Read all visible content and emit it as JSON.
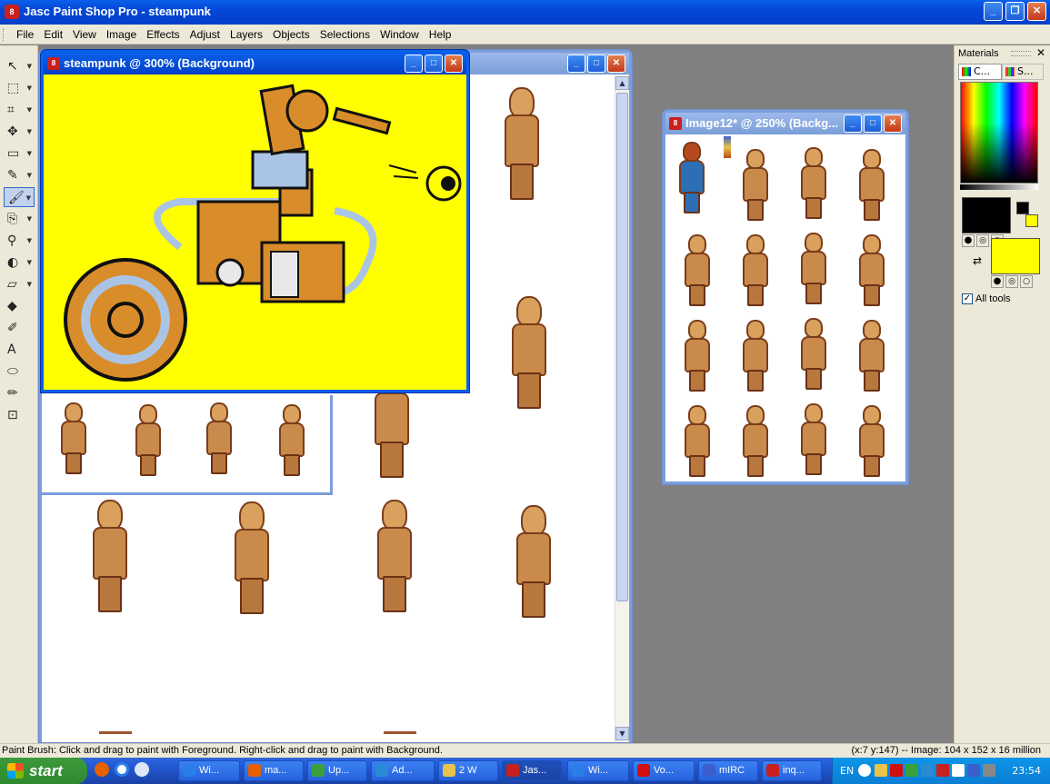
{
  "window": {
    "title": "Jasc Paint Shop Pro - steampunk",
    "icon_text": "8"
  },
  "menu": [
    "File",
    "Edit",
    "View",
    "Image",
    "Effects",
    "Adjust",
    "Layers",
    "Objects",
    "Selections",
    "Window",
    "Help"
  ],
  "tools": [
    {
      "name": "pan",
      "glyph": "↖"
    },
    {
      "name": "selection",
      "glyph": "⬚"
    },
    {
      "name": "crop",
      "glyph": "⌗"
    },
    {
      "name": "move",
      "glyph": "✥"
    },
    {
      "name": "select-rect",
      "glyph": "▭"
    },
    {
      "name": "dropper",
      "glyph": "✎"
    },
    {
      "name": "paint-brush",
      "glyph": "🖌"
    },
    {
      "name": "clone",
      "glyph": "⎘"
    },
    {
      "name": "zoom",
      "glyph": "⚲"
    },
    {
      "name": "dodge",
      "glyph": "◐"
    },
    {
      "name": "eraser",
      "glyph": "▱"
    },
    {
      "name": "fill",
      "glyph": "◆"
    },
    {
      "name": "pen",
      "glyph": "✐"
    },
    {
      "name": "text",
      "glyph": "A"
    },
    {
      "name": "shape",
      "glyph": "⬭"
    },
    {
      "name": "pencil",
      "glyph": "✏"
    },
    {
      "name": "deform",
      "glyph": "⊡"
    }
  ],
  "docs": {
    "back": {
      "title": ""
    },
    "steampunk": {
      "title": "steampunk @ 300% (Background)"
    },
    "image12": {
      "title": "Image12* @ 250% (Backg..."
    }
  },
  "materials": {
    "title": "Materials",
    "tab1": "C...",
    "tab2": "S...",
    "all_tools": "All tools",
    "all_tools_checked": true,
    "foreground_color": "#000000",
    "background_color": "#ffff00"
  },
  "status": {
    "left": "Paint Brush: Click and drag to paint with Foreground. Right-click and drag to paint with Background.",
    "right": "(x:7 y:147) -- Image:  104 x 152 x 16 million"
  },
  "taskbar": {
    "start": "start",
    "buttons": [
      {
        "label": "Wi...",
        "color": "#2b7de9"
      },
      {
        "label": "ma...",
        "color": "#e66000"
      },
      {
        "label": "Up...",
        "color": "#3aa13a"
      },
      {
        "label": "Ad...",
        "color": "#2a8ad4"
      },
      {
        "label": "2 W",
        "color": "#e8c44a"
      },
      {
        "label": "Jas...",
        "color": "#c8201e"
      },
      {
        "label": "Wi...",
        "color": "#2b7de9"
      },
      {
        "label": "Vo...",
        "color": "#d01010"
      },
      {
        "label": "mIRC",
        "color": "#3a5fcd"
      },
      {
        "label": "inq...",
        "color": "#c8201e"
      }
    ],
    "lang": "EN",
    "clock": "23:54"
  }
}
